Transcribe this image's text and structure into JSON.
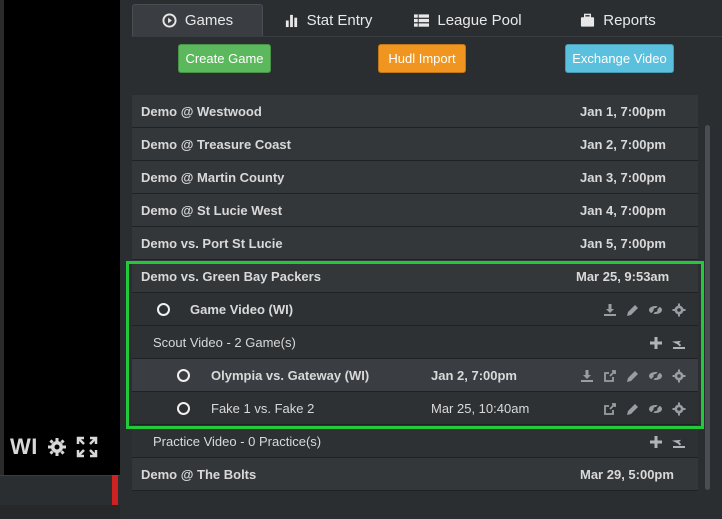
{
  "video": {
    "overlay_label": "WI"
  },
  "tabs": [
    {
      "label": "Games",
      "icon": "play-circle-icon",
      "active": true
    },
    {
      "label": "Stat Entry",
      "icon": "bar-chart-icon",
      "active": false
    },
    {
      "label": "League Pool",
      "icon": "list-icon",
      "active": false
    },
    {
      "label": "Reports",
      "icon": "briefcase-icon",
      "active": false
    }
  ],
  "buttons": {
    "create_game": "Create Game",
    "hudl_import": "Hudl Import",
    "exchange_video": "Exchange Video"
  },
  "colors": {
    "create": "#5cb85c",
    "hudl": "#f0951f",
    "exchange": "#5bc0de",
    "highlight": "#22c93a"
  },
  "games": [
    {
      "title": "Demo @ Westwood",
      "date": "Jan 1, 7:00pm"
    },
    {
      "title": "Demo @ Treasure Coast",
      "date": "Jan 2, 7:00pm"
    },
    {
      "title": "Demo @ Martin County",
      "date": "Jan 3, 7:00pm"
    },
    {
      "title": "Demo @ St Lucie West",
      "date": "Jan 4, 7:00pm"
    },
    {
      "title": "Demo vs. Port St Lucie",
      "date": "Jan 5, 7:00pm"
    }
  ],
  "selected_game": {
    "title": "Demo vs. Green Bay Packers",
    "date": "Mar 25, 9:53am",
    "game_video": "Game Video (WI)",
    "scout_header": "Scout Video - 2 Game(s)",
    "scout_games": [
      {
        "title": "Olympia vs. Gateway (WI)",
        "date": "Jan 2, 7:00pm"
      },
      {
        "title": "Fake 1 vs. Fake 2",
        "date": "Mar 25, 10:40am"
      }
    ],
    "practice_header": "Practice Video - 0 Practice(s)"
  },
  "after_games": [
    {
      "title": "Demo @ The Bolts",
      "date": "Mar 29, 5:00pm"
    }
  ]
}
